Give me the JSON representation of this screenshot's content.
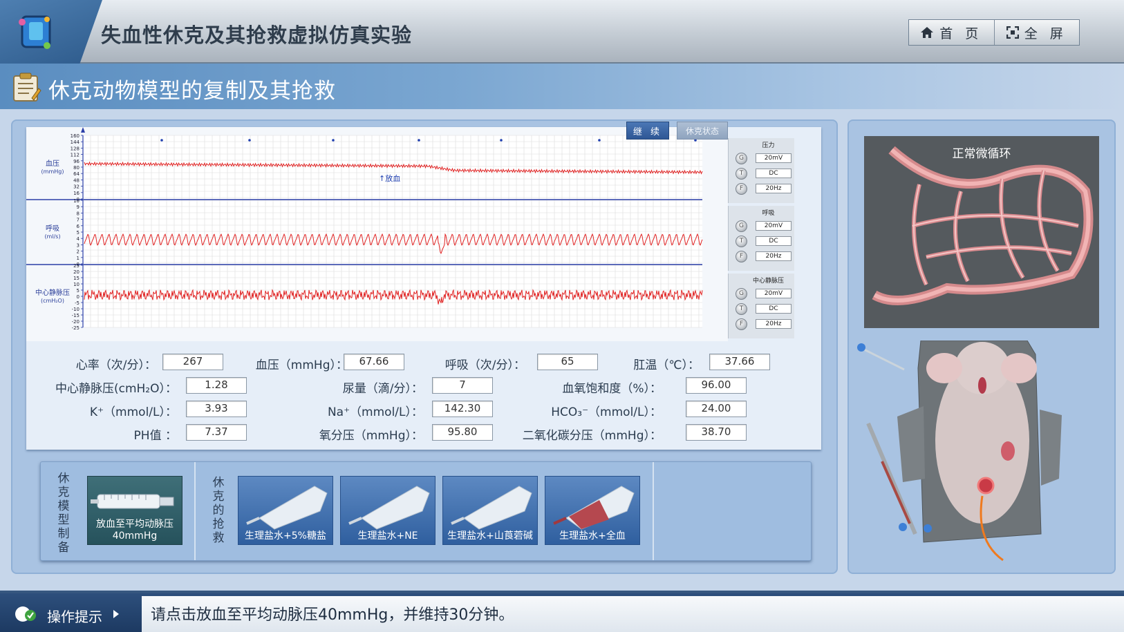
{
  "app": {
    "title": "失血性休克及其抢救虚拟仿真实验",
    "nav": [
      {
        "label": "首 页",
        "icon": "home-icon"
      },
      {
        "label": "全 屏",
        "icon": "fullscreen-icon"
      }
    ]
  },
  "section": {
    "title": "休克动物模型的复制及其抢救"
  },
  "monitor": {
    "buttons": {
      "continue": "继 续",
      "shock_state": "休克状态"
    },
    "channels": [
      {
        "name": "血压",
        "unit": "(mmHg)",
        "ticks": [
          "160",
          "144",
          "128",
          "112",
          "96",
          "80",
          "64",
          "48",
          "32",
          "16",
          "0"
        ],
        "ctrl_title": "压力",
        "settings": [
          "20mV",
          "DC",
          "20Hz"
        ]
      },
      {
        "name": "呼吸",
        "unit": "(ml/s)",
        "ticks": [
          "10",
          "9",
          "8",
          "7",
          "6",
          "5",
          "4",
          "3",
          "2",
          "1",
          "0"
        ],
        "ctrl_title": "呼吸",
        "settings": [
          "20mV",
          "DC",
          "20Hz"
        ]
      },
      {
        "name": "中心静脉压",
        "unit": "(cmH₂O)",
        "ticks": [
          "25",
          "20",
          "15",
          "10",
          "5",
          "0",
          "-5",
          "-10",
          "-15",
          "-20",
          "-25"
        ],
        "ctrl_title": "中心静脉压",
        "settings": [
          "20mV",
          "DC",
          "20Hz"
        ]
      }
    ],
    "knob_labels": [
      "G",
      "T",
      "F"
    ],
    "annotation": "↑放血"
  },
  "readouts": [
    {
      "label": "心率（次/分）：",
      "value": "267"
    },
    {
      "label": "血压（mmHg）：",
      "value": "67.66"
    },
    {
      "label": "呼吸（次/分）：",
      "value": "65"
    },
    {
      "label": "肛温（℃）：",
      "value": "37.66"
    },
    {
      "label": "中心静脉压(cmH₂O）：",
      "value": "1.28"
    },
    {
      "label": "尿量（滴/分）：",
      "value": "7"
    },
    {
      "label": "血氧饱和度（%）：",
      "value": "96.00"
    },
    {
      "label": "K⁺（mmol/L）：",
      "value": "3.93"
    },
    {
      "label": "Na⁺（mmol/L）：",
      "value": "142.30"
    },
    {
      "label": "HCO₃⁻（mmol/L）：",
      "value": "24.00"
    },
    {
      "label": "PH值 ：",
      "value": "7.37"
    },
    {
      "label": "氧分压（mmHg）：",
      "value": "95.80"
    },
    {
      "label": "二氧化碳分压（mmHg）：",
      "value": "38.70"
    }
  ],
  "tray": {
    "model_label": "休克模型制备",
    "rescue_label": "休克的抢救",
    "bleed_tool": "放血至平均动脉压\n40mmHg",
    "rescue_tools": [
      "生理盐水+5%糖盐",
      "生理盐水+NE",
      "生理盐水+山莨菪碱",
      "生理盐水+全血"
    ]
  },
  "micro": {
    "label": "正常微循环"
  },
  "hint": {
    "label": "操作提示",
    "text": "请点击放血至平均动脉压40mmHg，并维持30分钟。"
  },
  "colors": {
    "trace": "#e02020",
    "accent": "#2e5795",
    "panel": "#a9c3e2"
  }
}
